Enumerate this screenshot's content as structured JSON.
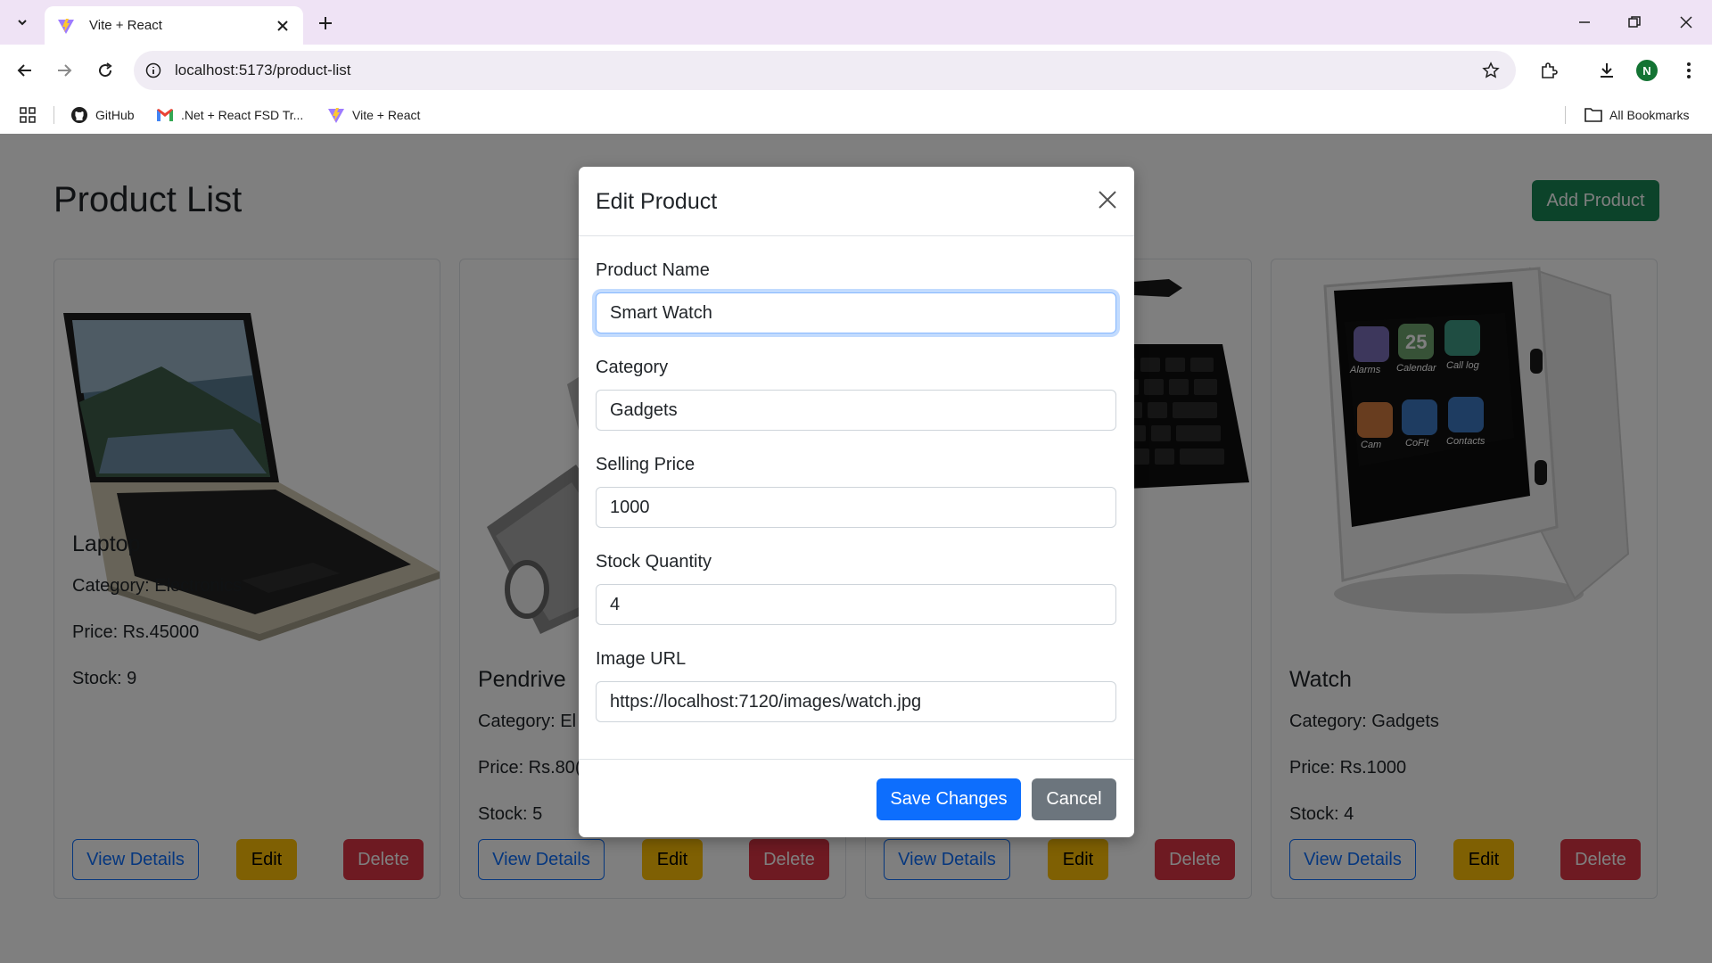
{
  "browser": {
    "tab_title": "Vite + React",
    "url": "localhost:5173/product-list",
    "profile_initial": "N",
    "bookmarks": [
      {
        "label": "GitHub",
        "icon": "github-icon"
      },
      {
        "label": ".Net + React FSD Tr...",
        "icon": "gmail-icon"
      },
      {
        "label": "Vite + React",
        "icon": "vite-icon"
      }
    ],
    "all_bookmarks_label": "All Bookmarks"
  },
  "page": {
    "title": "Product List",
    "add_button": "Add Product"
  },
  "products": [
    {
      "name": "Laptop",
      "category": "Category: Electronics",
      "price": "Price: Rs.45000",
      "stock": "Stock: 9",
      "view_label": "View Details",
      "edit_label": "Edit",
      "delete_label": "Delete"
    },
    {
      "name": "Pendrive",
      "category": "Category: El",
      "price": "Price: Rs.80(",
      "stock": "Stock: 5",
      "view_label": "View Details",
      "edit_label": "Edit",
      "delete_label": "Delete"
    },
    {
      "name": "",
      "category": "",
      "price": "",
      "stock": "",
      "view_label": "View Details",
      "edit_label": "Edit",
      "delete_label": "Delete"
    },
    {
      "name": "Watch",
      "category": "Category: Gadgets",
      "price": "Price: Rs.1000",
      "stock": "Stock: 4",
      "view_label": "View Details",
      "edit_label": "Edit",
      "delete_label": "Delete"
    }
  ],
  "watch_screen_labels": {
    "date": "25",
    "apps": [
      "Alarms",
      "Calendar",
      "Call log",
      "Cam",
      "CoFit",
      "Contacts"
    ]
  },
  "modal": {
    "title": "Edit Product",
    "fields": [
      {
        "label": "Product Name",
        "value": "Smart Watch"
      },
      {
        "label": "Category",
        "value": "Gadgets"
      },
      {
        "label": "Selling Price",
        "value": "1000"
      },
      {
        "label": "Stock Quantity",
        "value": "4"
      },
      {
        "label": "Image URL",
        "value": "https://localhost:7120/images/watch.jpg"
      }
    ],
    "save_label": "Save Changes",
    "cancel_label": "Cancel"
  },
  "colors": {
    "primary": "#0d6efd",
    "success": "#198754",
    "warning": "#ffc107",
    "danger": "#dc3545",
    "secondary": "#6c757d",
    "tabstrip": "#efe3f5"
  }
}
